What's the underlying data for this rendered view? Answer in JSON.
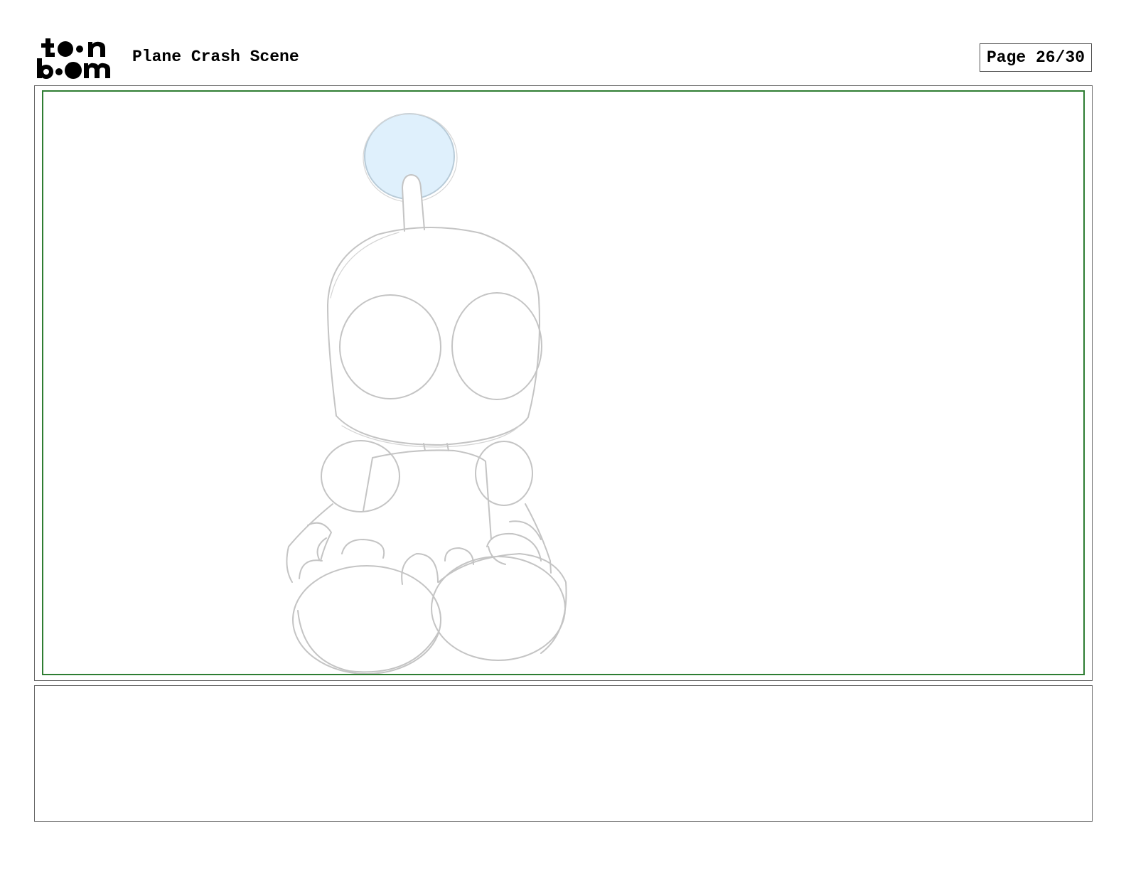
{
  "header": {
    "logo_line1": "toon",
    "logo_line2": "boom",
    "scene_title": "Plane Crash Scene",
    "page_label": "Page 26/30"
  },
  "panel": {
    "frame_color": "#2e7d32",
    "sketch_stroke_color": "#c4c4c4",
    "antenna_ball_fill": "#dff0fc"
  },
  "notes": {
    "text": ""
  }
}
